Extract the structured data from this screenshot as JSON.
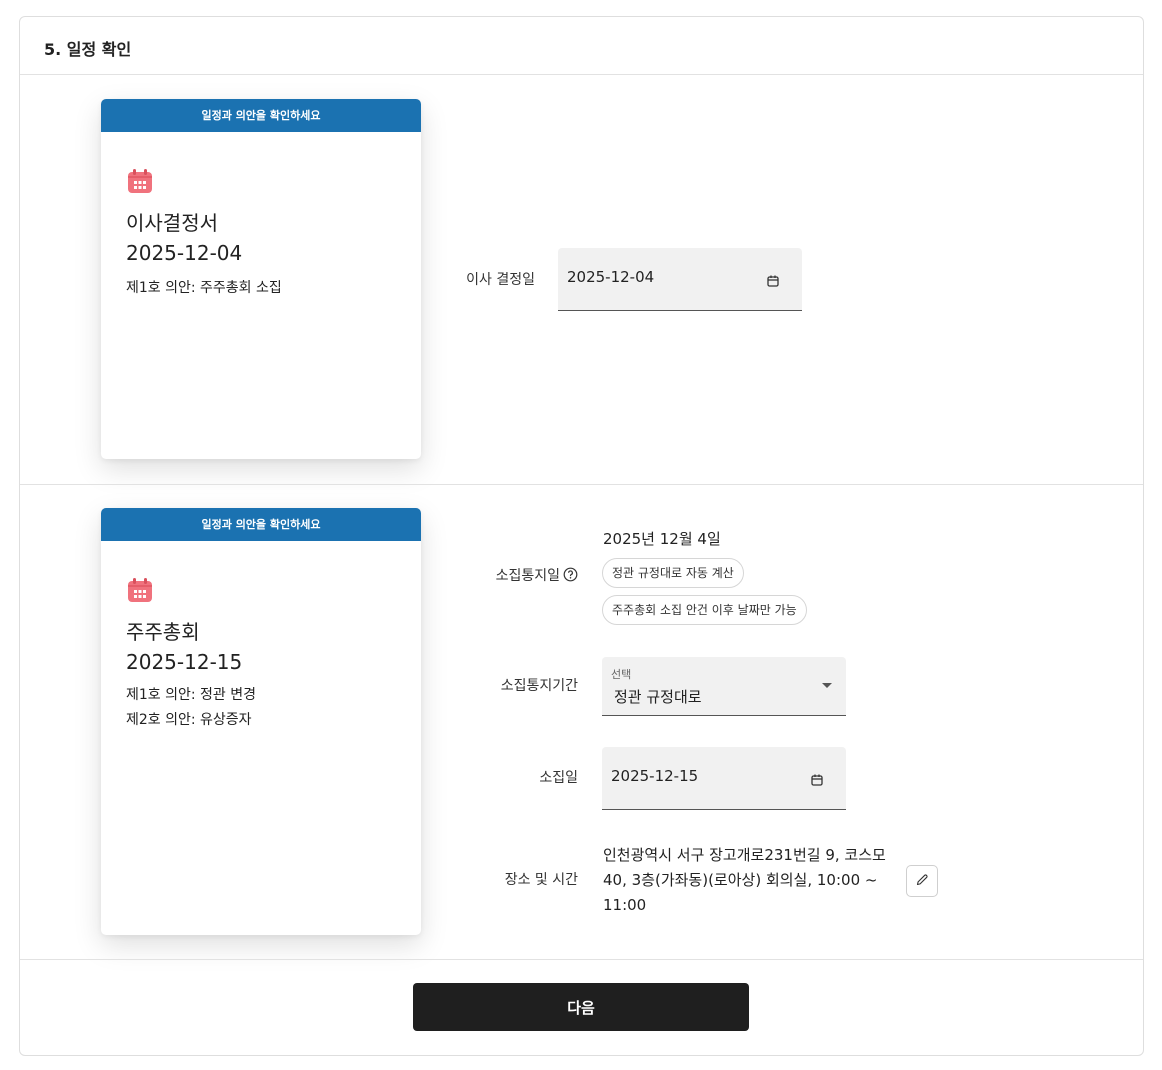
{
  "section": {
    "title": "5. 일정 확인"
  },
  "board_card": {
    "banner": "일정과 의안을 확인하세요",
    "icon": "calendar-icon",
    "title": "이사결정서",
    "date": "2025-12-04",
    "items": [
      "제1호 의안: 주주총회 소집"
    ]
  },
  "board_form": {
    "decision_date_label": "이사 결정일",
    "decision_date_value": "2025-12-04"
  },
  "meeting_card": {
    "banner": "일정과 의안을 확인하세요",
    "icon": "calendar-icon",
    "title": "주주총회",
    "date": "2025-12-15",
    "items": [
      "제1호 의안: 정관 변경",
      "제2호 의안: 유상증자"
    ]
  },
  "meeting_form": {
    "notice_date_label": "소집통지일",
    "notice_date_value": "2025년 12월 4일",
    "notice_chips": [
      "정관 규정대로 자동 계산",
      "주주총회 소집 안건 이후 날짜만 가능"
    ],
    "notice_period_label": "소집통지기간",
    "notice_period_caption": "선택",
    "notice_period_value": "정관 규정대로",
    "meeting_date_label": "소집일",
    "meeting_date_value": "2025-12-15",
    "place_time_label": "장소 및 시간",
    "place_time_value": "인천광역시 서구 장고개로231번길 9, 코스모 40, 3층(가좌동)(로아상) 회의실, 10:00 ~ 11:00"
  },
  "next_button": "다음",
  "colors": {
    "banner": "#1b72b1",
    "calendar_icon": "#f0727d",
    "primary_button": "#1f1f1f"
  }
}
